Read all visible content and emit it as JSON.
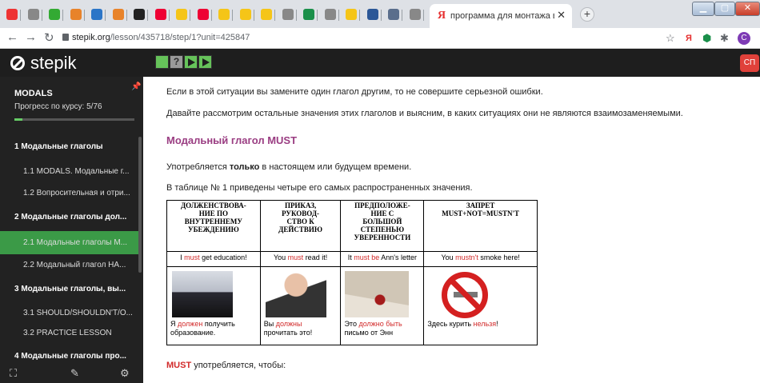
{
  "browser": {
    "active_tab_title": "программа для монтажа видео",
    "active_tab_icon": "yandex-icon",
    "url_host": "stepik.org",
    "url_path": "/lesson/435718/step/1?unit=425847",
    "profile_initial": "C",
    "tabs": [
      {
        "icon": "youtube-icon",
        "color": "#e33"
      },
      {
        "icon": "globe-icon",
        "color": "#888"
      },
      {
        "icon": "leaf-icon",
        "color": "#3a3"
      },
      {
        "icon": "bookmark-icon",
        "color": "#e8832a"
      },
      {
        "icon": "video-icon",
        "color": "#2b75c7"
      },
      {
        "icon": "bookmark-icon",
        "color": "#e8832a"
      },
      {
        "icon": "stepik-icon",
        "color": "#222"
      },
      {
        "icon": "h-icon",
        "color": "#e03"
      },
      {
        "icon": "yellow-tab-icon",
        "color": "#f5c518"
      },
      {
        "icon": "d-icon",
        "color": "#e03"
      },
      {
        "icon": "yellow-tab-icon",
        "color": "#f5c518"
      },
      {
        "icon": "yellow-tab-icon",
        "color": "#f5c518"
      },
      {
        "icon": "yellow-tab-icon",
        "color": "#f5c518"
      },
      {
        "icon": "globe-icon",
        "color": "#888"
      },
      {
        "icon": "plus-square-icon",
        "color": "#1a8f4a"
      },
      {
        "icon": "globe-icon",
        "color": "#888"
      },
      {
        "icon": "yellow-tab-icon",
        "color": "#f5c518"
      },
      {
        "icon": "t-icon",
        "color": "#2b5797"
      },
      {
        "icon": "house-icon",
        "color": "#5a6e8c"
      },
      {
        "icon": "globe-icon",
        "color": "#888"
      }
    ]
  },
  "stepik": {
    "logo": "stepik",
    "user_initials": "СП",
    "step_placeholder": "?"
  },
  "sidebar": {
    "course_title": "MODALS",
    "progress_label": "Прогресс по курсу:  5/76",
    "progress": 0.066,
    "items": [
      {
        "label": "1  Модальные глаголы",
        "type": "section",
        "active": false
      },
      {
        "label": "1.1  MODALS. Модальные г...",
        "type": "sub",
        "active": false
      },
      {
        "label": "1.2  Вопросительная и отри...",
        "type": "sub",
        "active": false
      },
      {
        "label": "2  Модальные глаголы дол...",
        "type": "section",
        "active": false
      },
      {
        "label": "2.1  Модальные глаголы М...",
        "type": "sub",
        "active": true
      },
      {
        "label": "2.2  Модальный глагол НА...",
        "type": "sub",
        "active": false
      },
      {
        "label": "3  Модальные глаголы, вы...",
        "type": "section",
        "active": false
      },
      {
        "label": "3.1  SHOULD/SHOULDN'T/O...",
        "type": "sub",
        "active": false
      },
      {
        "label": "3.2  PRACTICE LESSON",
        "type": "sub",
        "active": false
      },
      {
        "label": "4  Модальные глаголы про...",
        "type": "section",
        "active": false
      }
    ]
  },
  "content": {
    "p1": "Если в этой ситуации вы замените один глагол другим, то не совершите серьезной ошибки.",
    "p2": "Давайте рассмотрим остальные значения этих глаголов и выясним, в каких ситуациях они не являются взаимозаменяемыми.",
    "heading": "Модальный глагол MUST",
    "p3_before": "Употребляется ",
    "p3_bold": "только",
    "p3_after": " в настоящем или будущем времени.",
    "p4": "В таблице № 1 приведены четыре его самых распространенных значения.",
    "table": {
      "headers": [
        "ДОЛЖЕНСТВОВА-\nНИЕ ПО\nВНУТРЕННЕМУ\nУБЕЖДЕНИЮ",
        "ПРИКАЗ,\nРУКОВОД-\nСТВО К\nДЕЙСТВИЮ",
        "ПРЕДПОЛОЖЕ-\nНИЕ С\nБОЛЬШОЙ\nСТЕПЕНЬЮ\nУВЕРЕННОСТИ",
        "ЗАПРЕТ\nMUST+NOT=MUSTN'T"
      ],
      "examples": [
        {
          "pre": "I ",
          "red": "must",
          "post": " get education!"
        },
        {
          "pre": "You ",
          "red": "must",
          "post": " read it!"
        },
        {
          "pre": "It ",
          "red": "must be",
          "post": " Ann's letter"
        },
        {
          "pre": "You ",
          "red": "mustn't",
          "post": " smoke here!"
        }
      ],
      "captions": [
        {
          "pre": "Я ",
          "red": "должен",
          "post": " получить\nобразование."
        },
        {
          "pre": "Вы ",
          "red": "должны",
          "post": "\nпрочитать это!"
        },
        {
          "pre": "Это ",
          "red": "должно быть",
          "post": "\nписьмо от Энн"
        },
        {
          "pre": "Здесь курить ",
          "red": "нельзя",
          "post": "!"
        }
      ]
    },
    "must_bold": "MUST",
    "must_rest": " употребляется, чтобы:"
  }
}
